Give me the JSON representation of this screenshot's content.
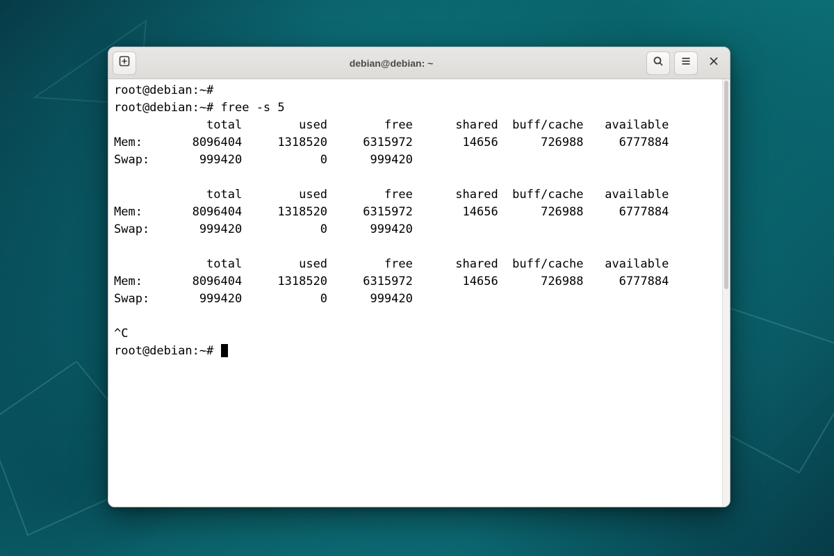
{
  "window": {
    "title": "debian@debian: ~"
  },
  "prompt": "root@debian:~#",
  "command": "free -s 5",
  "columns": {
    "c0_w": 5,
    "c1_w": 13,
    "c2_w": 12,
    "c3_w": 12,
    "c4_w": 12,
    "c5_w": 12,
    "c6_w": 12
  },
  "header_labels": {
    "total": "total",
    "used": "used",
    "free": "free",
    "shared": "shared",
    "buff": "buff/cache",
    "avail": "available"
  },
  "row_labels": {
    "mem": "Mem:",
    "swap": "Swap:"
  },
  "snapshots": [
    {
      "mem": {
        "total": 8096404,
        "used": 1318520,
        "free": 6315972,
        "shared": 14656,
        "buff": 726988,
        "avail": 6777884
      },
      "swap": {
        "total": 999420,
        "used": 0,
        "free": 999420
      }
    },
    {
      "mem": {
        "total": 8096404,
        "used": 1318520,
        "free": 6315972,
        "shared": 14656,
        "buff": 726988,
        "avail": 6777884
      },
      "swap": {
        "total": 999420,
        "used": 0,
        "free": 999420
      }
    },
    {
      "mem": {
        "total": 8096404,
        "used": 1318520,
        "free": 6315972,
        "shared": 14656,
        "buff": 726988,
        "avail": 6777884
      },
      "swap": {
        "total": 999420,
        "used": 0,
        "free": 999420
      }
    }
  ],
  "interrupt": "^C",
  "icons": {
    "new_tab": "new-tab-icon",
    "search": "search-icon",
    "menu": "hamburger-menu-icon",
    "close": "close-icon"
  }
}
